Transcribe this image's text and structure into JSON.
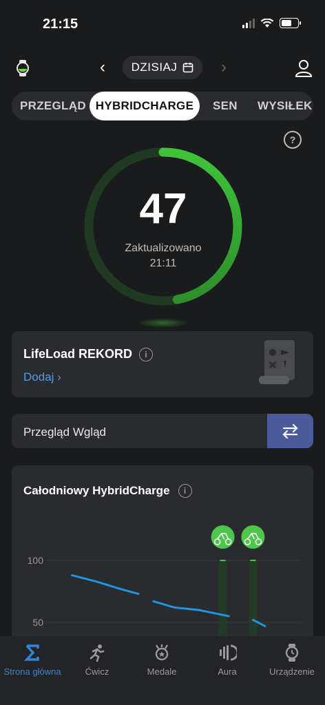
{
  "status": {
    "time": "21:15"
  },
  "header": {
    "date_label": "DZISIAJ"
  },
  "tabs": [
    {
      "label": "PRZEGLĄD"
    },
    {
      "label": "HYBRIDCHARGE",
      "active": true
    },
    {
      "label": "SEN"
    },
    {
      "label": "WYSIŁEK"
    }
  ],
  "hybridcharge": {
    "score": "47",
    "updated_label": "Zaktualizowano",
    "updated_time": "21:11",
    "level": 0.47
  },
  "lifeload": {
    "title": "LifeLoad REKORD",
    "add_label": "Dodaj"
  },
  "insight": {
    "label": "Przegląd Wgląd"
  },
  "chart": {
    "title": "Całodniowy HybridCharge"
  },
  "chart_data": {
    "type": "line",
    "title": "Całodniowy HybridCharge",
    "yticks": [
      "100",
      "50"
    ],
    "ylim": [
      40,
      110
    ],
    "series": [
      {
        "values": [
          [
            0.2,
            88
          ],
          [
            0.28,
            83
          ],
          [
            0.36,
            77
          ],
          [
            0.42,
            73
          ]
        ]
      },
      {
        "values": [
          [
            0.47,
            67
          ],
          [
            0.54,
            62
          ],
          [
            0.62,
            60
          ],
          [
            0.68,
            57
          ],
          [
            0.72,
            55
          ]
        ]
      },
      {
        "values": [
          [
            0.8,
            52
          ],
          [
            0.84,
            47
          ]
        ]
      }
    ],
    "activity_markers": [
      {
        "x": 0.7,
        "icon": "bike-icon"
      },
      {
        "x": 0.8,
        "icon": "exercise-bike-icon"
      }
    ],
    "colors": {
      "line": "#1e95e0",
      "marker": "#4cc74a"
    }
  },
  "nav": [
    {
      "label": "Strona główna",
      "icon": "home-sigma-icon",
      "active": true
    },
    {
      "label": "Ćwicz",
      "icon": "run-icon"
    },
    {
      "label": "Medale",
      "icon": "medal-icon"
    },
    {
      "label": "Aura",
      "icon": "aura-icon"
    },
    {
      "label": "Urządzenie",
      "icon": "watch-icon"
    }
  ]
}
